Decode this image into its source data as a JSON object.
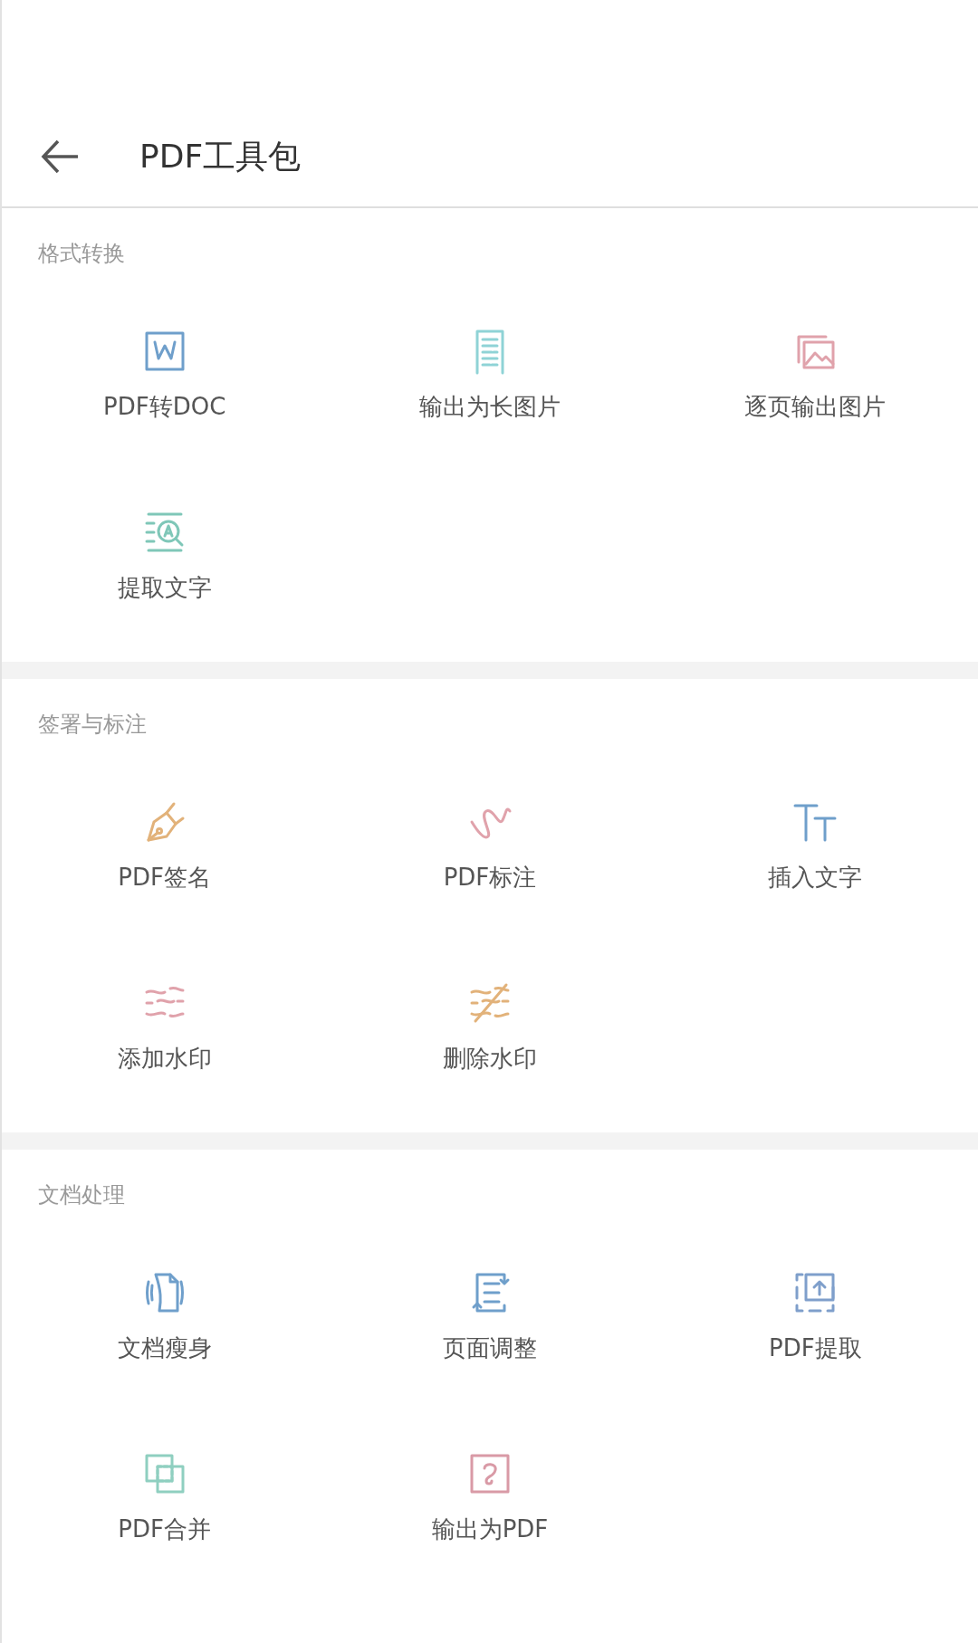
{
  "header": {
    "title": "PDF工具包"
  },
  "sections": [
    {
      "title": "格式转换",
      "tools": [
        {
          "label": "PDF转DOC",
          "kind": "word",
          "color": "#6f9fcb"
        },
        {
          "label": "输出为长图片",
          "kind": "longpage",
          "color": "#8fd3d6"
        },
        {
          "label": "逐页输出图片",
          "kind": "images",
          "color": "#e0a2ab"
        },
        {
          "label": "提取文字",
          "kind": "ocr",
          "color": "#7fc7b8"
        }
      ]
    },
    {
      "title": "签署与标注",
      "tools": [
        {
          "label": "PDF签名",
          "kind": "pen",
          "color": "#e2b27a"
        },
        {
          "label": "PDF标注",
          "kind": "scribble",
          "color": "#e0a2ab"
        },
        {
          "label": "插入文字",
          "kind": "text",
          "color": "#6f9fcb"
        },
        {
          "label": "添加水印",
          "kind": "waves",
          "color": "#e0a2ab"
        },
        {
          "label": "删除水印",
          "kind": "nowaves",
          "color": "#e2b27a"
        }
      ]
    },
    {
      "title": "文档处理",
      "tools": [
        {
          "label": "文档瘦身",
          "kind": "slim",
          "color": "#6f9fcb"
        },
        {
          "label": "页面调整",
          "kind": "reorder",
          "color": "#6f9fcb"
        },
        {
          "label": "PDF提取",
          "kind": "extract",
          "color": "#7f9fcb"
        },
        {
          "label": "PDF合并",
          "kind": "merge",
          "color": "#8fcfc0"
        },
        {
          "label": "输出为PDF",
          "kind": "topdf",
          "color": "#d99aa6"
        }
      ]
    }
  ]
}
